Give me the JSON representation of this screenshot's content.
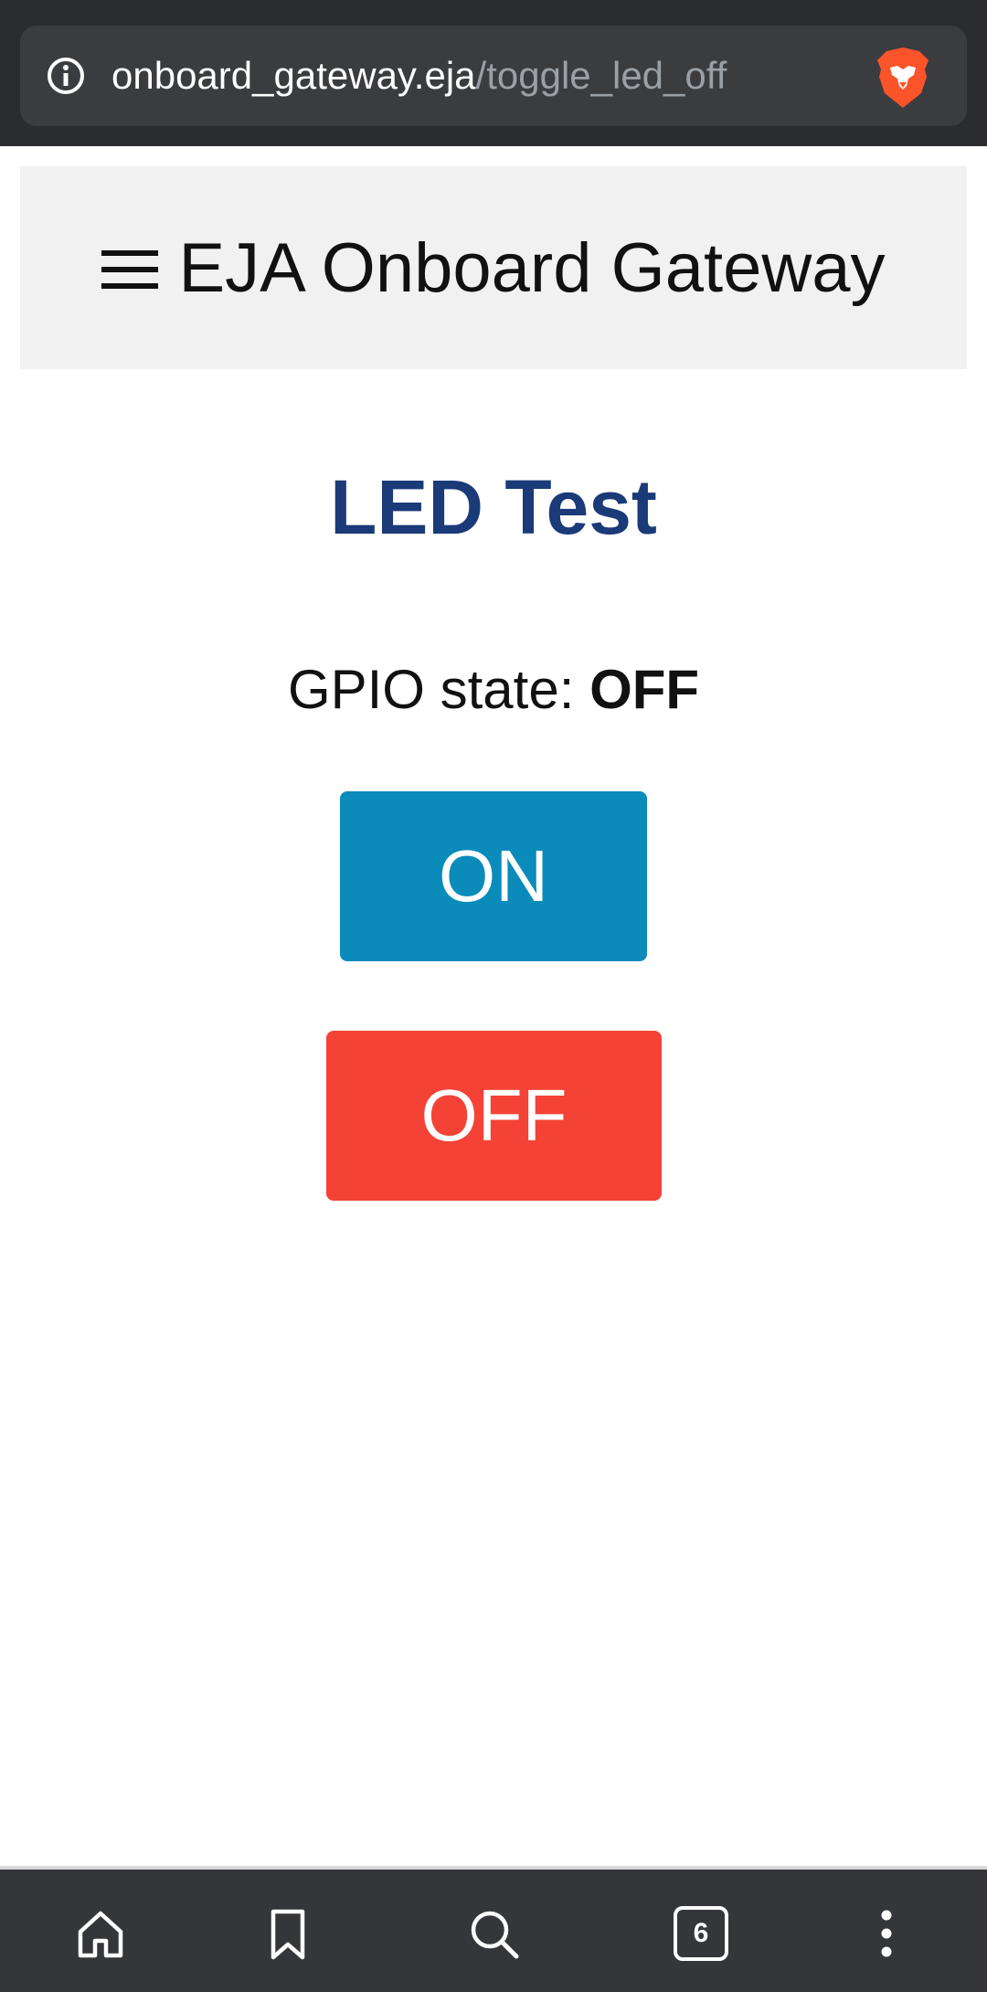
{
  "browser": {
    "url_domain": "onboard_gateway.eja",
    "url_path": "/toggle_led_off",
    "tab_count": "6",
    "icons": {
      "info": "info-icon",
      "brave": "brave-lion-icon",
      "home": "home-icon",
      "bookmark": "bookmark-icon",
      "search": "search-icon",
      "tabs": "tabs-counter-icon",
      "menu": "more-vertical-icon"
    }
  },
  "header": {
    "title": "EJA Onboard Gateway",
    "menu_icon": "hamburger-menu-icon"
  },
  "main": {
    "heading": "LED Test",
    "gpio_label": "GPIO state: ",
    "gpio_value": "OFF",
    "on_button": "ON",
    "off_button": "OFF"
  },
  "colors": {
    "heading": "#1a3a78",
    "on_button": "#0a8bba",
    "off_button": "#f44336",
    "header_bg": "#f1f1f1",
    "browser_chrome": "#2b2c30"
  }
}
